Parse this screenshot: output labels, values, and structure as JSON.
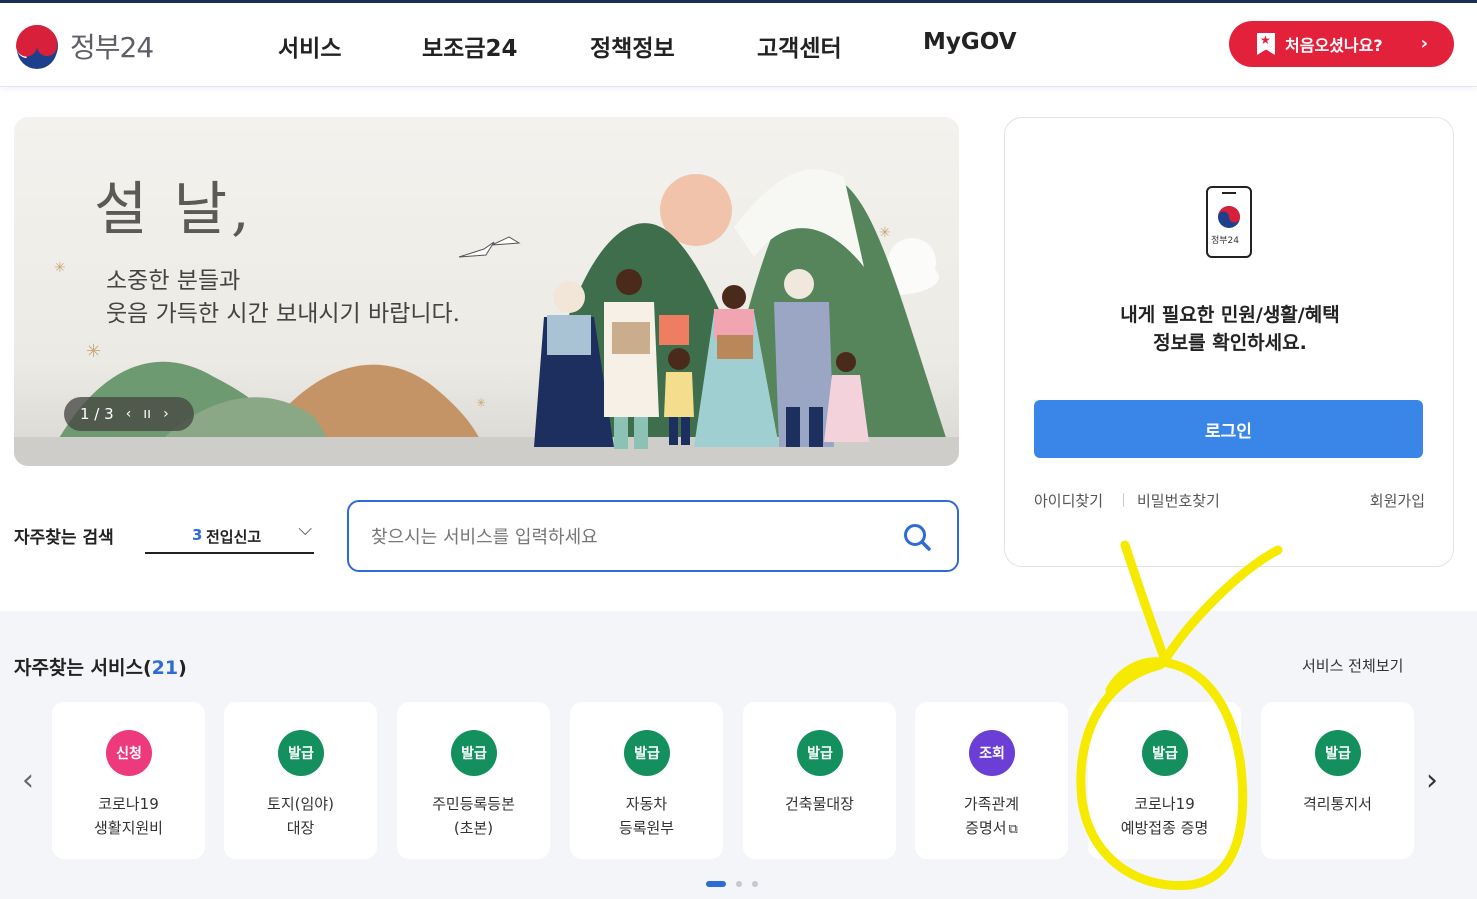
{
  "header": {
    "logo_text": "정부24",
    "nav": [
      "서비스",
      "보조금24",
      "정책정보",
      "고객센터",
      "MyGOV"
    ],
    "first_visit_label": "처음오셨나요?"
  },
  "banner": {
    "title": "설 날,",
    "subtitle_line1": "소중한 분들과",
    "subtitle_line2": "웃음 가득한 시간 보내시기 바랍니다.",
    "pager": "1 / 3"
  },
  "login": {
    "phone_label": "정부24",
    "message_line1": "내게 필요한 민원/생활/혜택",
    "message_line2": "정보를 확인하세요.",
    "login_button": "로그인",
    "find_id": "아이디찾기",
    "find_password": "비밀번호찾기",
    "signup": "회원가입"
  },
  "search": {
    "frequent_label": "자주찾는 검색",
    "frequent_rank": "3",
    "frequent_value": "전입신고",
    "placeholder": "찾으시는 서비스를 입력하세요"
  },
  "services": {
    "title": "자주찾는 서비스",
    "count": "21",
    "view_all": "서비스 전체보기",
    "items": [
      {
        "badge": "신청",
        "color": "#ec3a7c",
        "line1": "코로나19",
        "line2": "생활지원비"
      },
      {
        "badge": "발급",
        "color": "#14905f",
        "line1": "토지(임야)",
        "line2": "대장"
      },
      {
        "badge": "발급",
        "color": "#14905f",
        "line1": "주민등록등본",
        "line2": "(초본)"
      },
      {
        "badge": "발급",
        "color": "#14905f",
        "line1": "자동차",
        "line2": "등록원부"
      },
      {
        "badge": "발급",
        "color": "#14905f",
        "line1": "건축물대장",
        "line2": ""
      },
      {
        "badge": "조회",
        "color": "#6b3fd6",
        "line1": "가족관계",
        "line2": "증명서"
      },
      {
        "badge": "발급",
        "color": "#14905f",
        "line1": "코로나19",
        "line2": "예방접종 증명"
      },
      {
        "badge": "발급",
        "color": "#14905f",
        "line1": "격리통지서",
        "line2": ""
      }
    ]
  },
  "colors": {
    "primary_blue": "#2e6bd6",
    "login_blue": "#3a86e8",
    "accent_red": "#e4213b",
    "annotation_yellow": "#f5ea00"
  }
}
